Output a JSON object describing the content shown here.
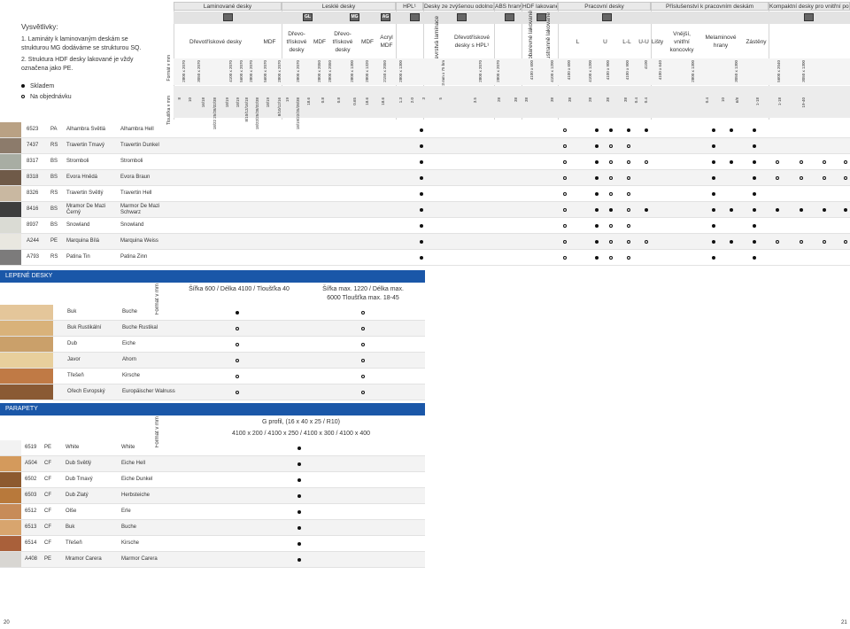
{
  "notes": {
    "title": "Vysvětlivky:",
    "items": [
      {
        "n": "1.",
        "text": "Lamináty k laminovaným deskám se strukturou MG dodáváme se strukturou SQ."
      },
      {
        "n": "2.",
        "text": "Struktura HDF desky lakované je vždy označena jako PE."
      }
    ],
    "legend": [
      {
        "symbol": "filled",
        "label": "Skladem"
      },
      {
        "symbol": "ring",
        "label": "Na objednávku"
      }
    ]
  },
  "groups": [
    "Laminované desky",
    "Lesklé desky",
    "HPL¹",
    "Desky ze zvýšenou odolností",
    "ABS hrany",
    "HDF lakované²",
    "Pracovní desky",
    "Příslušenství k pracovním deskám",
    "Kompaktní desky pro vnitřní použití"
  ],
  "icons": [
    "GL",
    "MG",
    "AG"
  ],
  "subheads": {
    "laminated_pb": "Dřevotřískové desky",
    "laminated_mdf": "MDF",
    "gloss_pb1": "Dřevo-třískové desky",
    "gloss_mdf1": "MDF",
    "gloss_pb2": "Dřevo-třískové desky",
    "gloss_mdf2": "MDF",
    "acryl": "Acryl MDF",
    "hpl_vertical": "Vícevrstvá laminace",
    "resist": "Dřevotřískové desky s HPL¹",
    "abs1": "Jednobarevné lakované",
    "abs2": "Oboustranně lakované",
    "L": "L",
    "U": "U",
    "LL": "L-L",
    "UU": "U-U",
    "listy": "Lišty",
    "koncovky": "Vnější, vnitřní koncovky",
    "melamin": "Melaminové hrany",
    "zastena": "Zástěny"
  },
  "side_labels": {
    "format": "Formát v mm",
    "thickness": "Tloušťka v mm"
  },
  "format_values": [
    "2800 x 2070",
    "3050 x 2070",
    "4100 x 2070",
    "5600 x 2070",
    "2800 x 2070",
    "5600 x 2070",
    "2800 x 2070",
    "2800 x 2070",
    "2800 x 2050",
    "2800 x 2050",
    "2800 x 1300",
    "2800 x 1320",
    "2150 x 2050",
    "2800 x 1300",
    "23 mm x 75 bm",
    "2800 x 2070",
    "2800 x 2070",
    "4100 x 600",
    "4100 x 1200",
    "4100 x 600",
    "4100 x 1200",
    "4100 x 900",
    "4100 x 900",
    "4100",
    "4100 x 640",
    "2800 x 1300",
    "3050 x 1300",
    "5600 x 2040",
    "3050 x 1300"
  ],
  "thickness_values": [
    "8",
    "10",
    "16/18",
    "18/22 25/28/32/38",
    "18/19",
    "18/19",
    "8/10/12/16/18",
    "18/22/25/28/32/38",
    "18/19",
    "8/10/12/16",
    "19",
    "18/19/22/25/28/38",
    "18.6",
    "0.8",
    "0.8",
    "0.65",
    "18.6",
    "18.6",
    "1.3",
    "2.0",
    "3",
    "5",
    "3.5",
    "28",
    "38",
    "38",
    "38",
    "38",
    "28",
    "38",
    "38",
    "0.4",
    "0.4",
    "0.4",
    "10",
    "6/8",
    "1-18",
    "1-18",
    "19-40"
  ],
  "decor_rows": [
    {
      "code": "6523",
      "struct": "PA",
      "cz": "Alhambra Světlá",
      "de": "Alhambra Hell",
      "swatch": "#b9a184",
      "marks": [
        [
          "f",
          476
        ],
        [
          "r",
          638
        ],
        [
          "f",
          674
        ],
        [
          "f",
          690
        ],
        [
          "f",
          710
        ],
        [
          "f",
          730
        ],
        [
          "f",
          806
        ],
        [
          "f",
          826
        ],
        [
          "f",
          852
        ]
      ]
    },
    {
      "code": "7437",
      "struct": "RS",
      "cz": "Travertin Tmavý",
      "de": "Travertin Dunkel",
      "swatch": "#8c7b6b",
      "marks": [
        [
          "f",
          476
        ],
        [
          "r",
          638
        ],
        [
          "f",
          674
        ],
        [
          "r",
          690
        ],
        [
          "r",
          710
        ],
        [
          "f",
          806
        ],
        [
          "f",
          852
        ]
      ]
    },
    {
      "code": "8317",
      "struct": "BS",
      "cz": "Stromboli",
      "de": "Stromboli",
      "swatch": "#a8ada3",
      "marks": [
        [
          "f",
          476
        ],
        [
          "r",
          638
        ],
        [
          "f",
          674
        ],
        [
          "r",
          690
        ],
        [
          "r",
          710
        ],
        [
          "r",
          730
        ],
        [
          "f",
          806
        ],
        [
          "f",
          826
        ],
        [
          "f",
          852
        ],
        [
          "r",
          878
        ],
        [
          "r",
          905
        ],
        [
          "r",
          931
        ],
        [
          "r",
          955
        ]
      ]
    },
    {
      "code": "8318",
      "struct": "BS",
      "cz": "Evora Hnědá",
      "de": "Evora Braun",
      "swatch": "#6f5a48",
      "marks": [
        [
          "f",
          476
        ],
        [
          "r",
          638
        ],
        [
          "f",
          674
        ],
        [
          "r",
          690
        ],
        [
          "r",
          710
        ],
        [
          "f",
          806
        ],
        [
          "f",
          852
        ],
        [
          "r",
          878
        ],
        [
          "r",
          905
        ],
        [
          "r",
          931
        ],
        [
          "r",
          955
        ]
      ]
    },
    {
      "code": "8326",
      "struct": "RS",
      "cz": "Travertin Světlý",
      "de": "Travertin Hell",
      "swatch": "#c9b8a1",
      "marks": [
        [
          "f",
          476
        ],
        [
          "r",
          638
        ],
        [
          "f",
          674
        ],
        [
          "r",
          690
        ],
        [
          "r",
          710
        ],
        [
          "f",
          806
        ],
        [
          "f",
          852
        ]
      ]
    },
    {
      "code": "8416",
      "struct": "BS",
      "cz": "Mramor De Mazi Černý",
      "de": "Marmor De Mazi Schwarz",
      "swatch": "#3d3d3d",
      "marks": [
        [
          "f",
          476
        ],
        [
          "r",
          638
        ],
        [
          "f",
          674
        ],
        [
          "f",
          690
        ],
        [
          "r",
          710
        ],
        [
          "f",
          730
        ],
        [
          "f",
          806
        ],
        [
          "f",
          826
        ],
        [
          "f",
          852
        ],
        [
          "f",
          878
        ],
        [
          "f",
          905
        ],
        [
          "f",
          931
        ],
        [
          "f",
          955
        ]
      ]
    },
    {
      "code": "8937",
      "struct": "BS",
      "cz": "Snowland",
      "de": "Snowland",
      "swatch": "#dadbd4",
      "marks": [
        [
          "f",
          476
        ],
        [
          "r",
          638
        ],
        [
          "f",
          674
        ],
        [
          "r",
          690
        ],
        [
          "r",
          710
        ],
        [
          "f",
          806
        ],
        [
          "f",
          852
        ]
      ]
    },
    {
      "code": "A244",
      "struct": "PE",
      "cz": "Marquina Bílá",
      "de": "Marquina Weiss",
      "swatch": "#e9e7e0",
      "marks": [
        [
          "f",
          476
        ],
        [
          "r",
          638
        ],
        [
          "f",
          674
        ],
        [
          "r",
          690
        ],
        [
          "r",
          710
        ],
        [
          "r",
          730
        ],
        [
          "f",
          806
        ],
        [
          "f",
          826
        ],
        [
          "f",
          852
        ],
        [
          "r",
          878
        ],
        [
          "r",
          905
        ],
        [
          "r",
          931
        ],
        [
          "r",
          955
        ]
      ]
    },
    {
      "code": "A793",
      "struct": "RS",
      "cz": "Patina Tin",
      "de": "Patina Zinn",
      "swatch": "#7c7b7b",
      "marks": [
        [
          "f",
          476
        ],
        [
          "r",
          638
        ],
        [
          "f",
          674
        ],
        [
          "r",
          690
        ],
        [
          "r",
          710
        ],
        [
          "f",
          806
        ],
        [
          "f",
          852
        ]
      ]
    }
  ],
  "glued": {
    "title": "LEPENÉ DESKY",
    "format_label": "Formát v mm",
    "col1": "Šířka 600 / Délka 4100 / Tloušťka 40",
    "col2": "Šířka max. 1220 / Délka max. 6000 Tloušťka max. 18-45",
    "rows": [
      {
        "cz": "Buk",
        "de": "Buche",
        "c1": "f",
        "c2": "r",
        "swatch": "#e4c69a"
      },
      {
        "cz": "Buk Rustikální",
        "de": "Buche Rustikal",
        "c1": "r",
        "c2": "r",
        "swatch": "#d9b27a"
      },
      {
        "cz": "Dub",
        "de": "Eiche",
        "c1": "r",
        "c2": "r",
        "swatch": "#caa06a"
      },
      {
        "cz": "Javor",
        "de": "Ahorn",
        "c1": "r",
        "c2": "r",
        "swatch": "#e8cf9c"
      },
      {
        "cz": "Třešeň",
        "de": "Kirsche",
        "c1": "r",
        "c2": "r",
        "swatch": "#c07a45"
      },
      {
        "cz": "Ořech Evropský",
        "de": "Europäischer Walnuss",
        "c1": "r",
        "c2": "r",
        "swatch": "#8a5a34"
      }
    ]
  },
  "parapety": {
    "title": "PARAPETY",
    "format_label": "Formát v mm",
    "line1": "G profil, (16 x 40 x 25 / R10)",
    "line2": "4100 x 200 / 4100 x 250 / 4100 x 300 / 4100 x 400",
    "rows": [
      {
        "code": "6519",
        "struct": "PE",
        "cz": "White",
        "de": "White",
        "swatch": "#f2f2f2"
      },
      {
        "code": "A504",
        "struct": "CF",
        "cz": "Dub Světlý",
        "de": "Eiche Hell",
        "swatch": "#d49a5c"
      },
      {
        "code": "6502",
        "struct": "CF",
        "cz": "Dub Tmavý",
        "de": "Eiche Dunkel",
        "swatch": "#8d5a2f"
      },
      {
        "code": "6503",
        "struct": "CF",
        "cz": "Dub Zlatý",
        "de": "Herbsteiche",
        "swatch": "#b8793b"
      },
      {
        "code": "6512",
        "struct": "CF",
        "cz": "Olše",
        "de": "Erle",
        "swatch": "#c78b58"
      },
      {
        "code": "6513",
        "struct": "CF",
        "cz": "Buk",
        "de": "Buche",
        "swatch": "#d8a56e"
      },
      {
        "code": "6514",
        "struct": "CF",
        "cz": "Třešeň",
        "de": "Kirsche",
        "swatch": "#a9603a"
      },
      {
        "code": "A408",
        "struct": "PE",
        "cz": "Mramor Carera",
        "de": "Marmor Carera",
        "swatch": "#d8d6d2"
      }
    ]
  },
  "pages": {
    "left": "20",
    "right": "21"
  }
}
